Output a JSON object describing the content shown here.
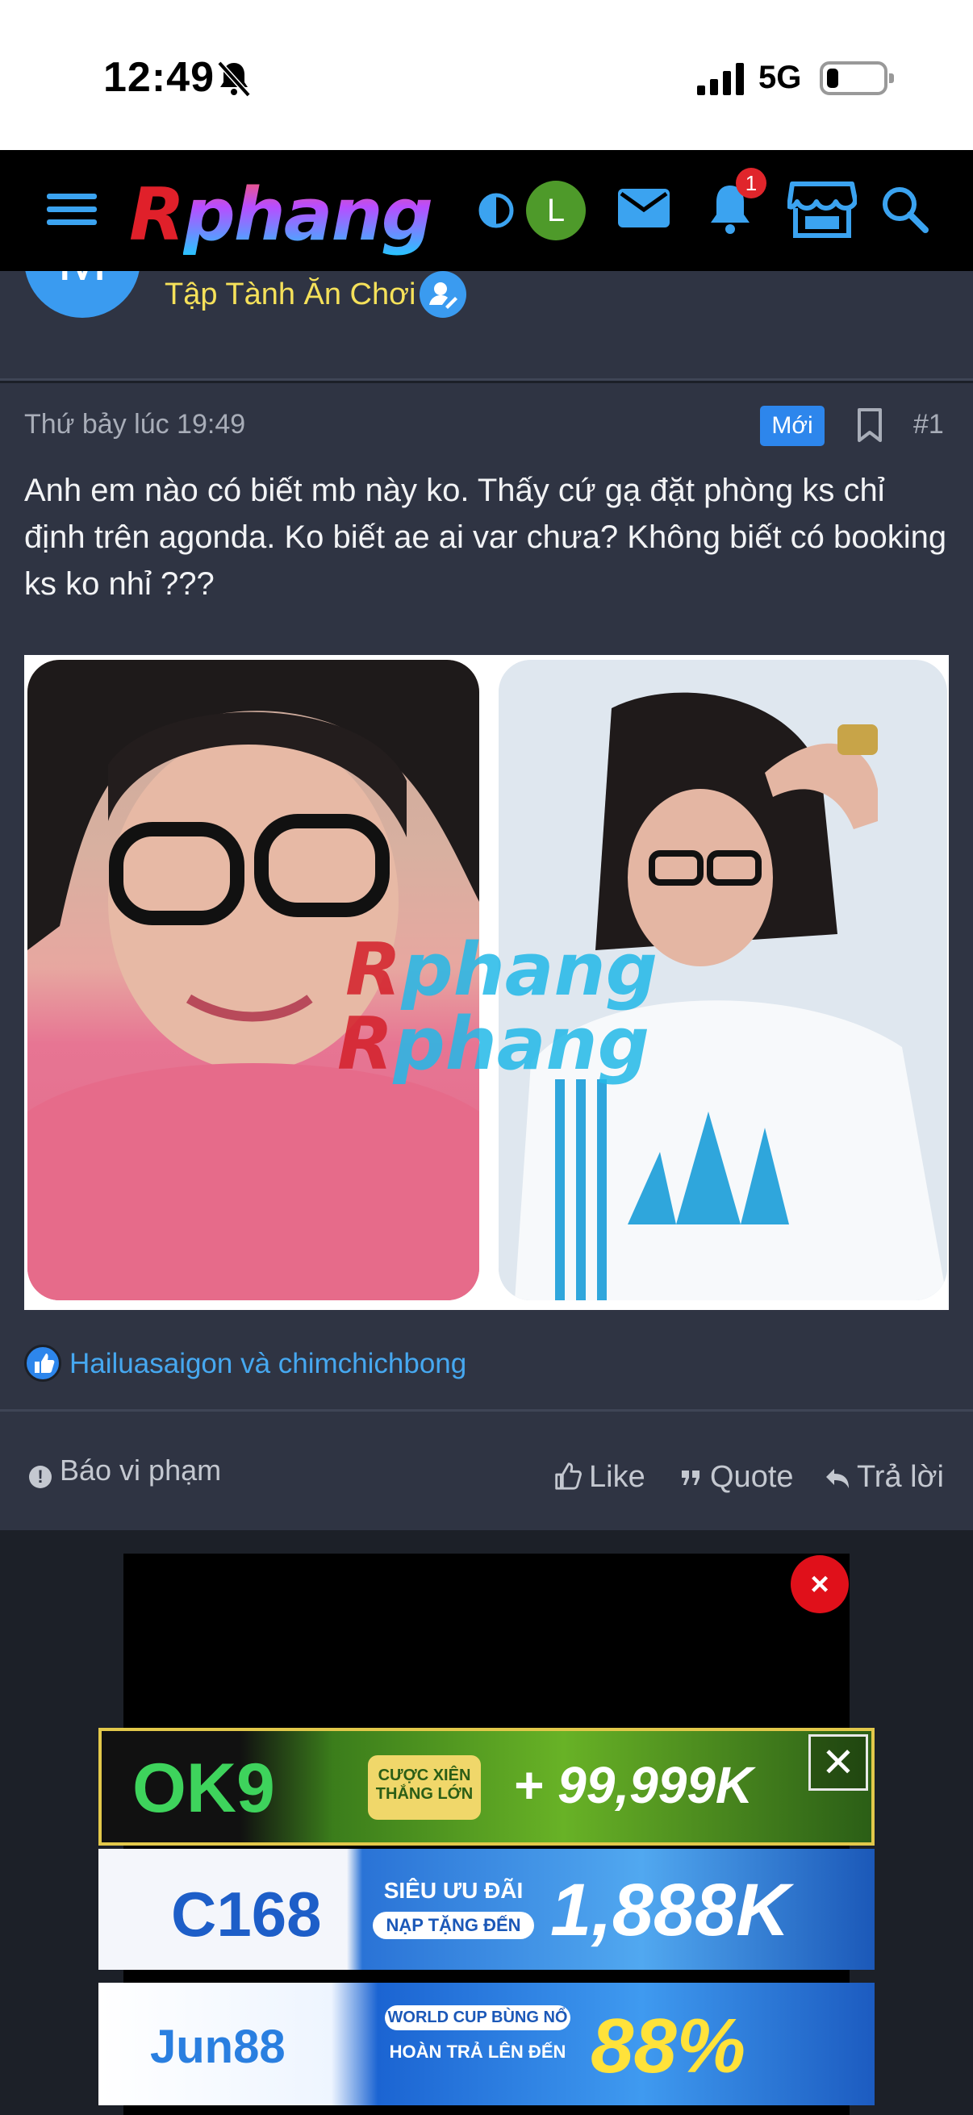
{
  "status_bar": {
    "time": "12:49",
    "network": "5G",
    "icons": [
      "bell-slash-icon",
      "signal-icon",
      "battery-icon"
    ]
  },
  "nav": {
    "logo_r": "R",
    "logo_rest": "phang",
    "avatar_letter": "L",
    "notification_count": "1",
    "icons": [
      "menu-icon",
      "contrast-icon",
      "mail-icon",
      "bell-icon",
      "store-icon",
      "search-icon"
    ]
  },
  "thread": {
    "avatar_letter": "M",
    "title": "Tập Tành Ăn Chơi",
    "title_color": "#f5e15a"
  },
  "post": {
    "date": "Thứ bảy lúc 19:49",
    "new_badge": "Mới",
    "number": "#1",
    "body": "Anh em nào có biết mb này ko. Thấy cứ gạ đặt phòng ks chỉ định trên agonda. Ko biết ae ai var chưa? Không biết có booking ks ko nhỉ ???",
    "image": {
      "watermark_line1_r": "R",
      "watermark_line1_rest": "phang",
      "watermark_line2_r": "R",
      "watermark_line2_rest": "phang"
    },
    "reactions_text": "Hailuasaigon và chimchichbong",
    "actions": {
      "report": "Báo vi phạm",
      "like": "Like",
      "quote": "Quote",
      "reply": "Trả lời"
    }
  },
  "ads": {
    "close_label": "×",
    "banner_close_label": "✕",
    "ok9": {
      "logo": "OK9",
      "tag_line1": "CƯỢC XIÊN",
      "tag_line2": "THẮNG LỚN",
      "amount": "+ 99,999K"
    },
    "c168": {
      "logo": "C168",
      "tag_line1": "SIÊU ƯU ĐÃI",
      "tag_line2": "NẠP TẶNG ĐẾN",
      "amount": "1,888K"
    },
    "jun88": {
      "logo": "Jun88",
      "tag_line1": "WORLD CUP BÙNG NỔ",
      "tag_line2": "HOÀN TRẢ LÊN ĐẾN",
      "amount": "88%"
    }
  },
  "colors": {
    "page_bg": "#1c2028",
    "panel_bg": "#2f3443",
    "accent_blue": "#2d86ec",
    "link_blue": "#46a8f0",
    "badge_red": "#e0252b"
  }
}
